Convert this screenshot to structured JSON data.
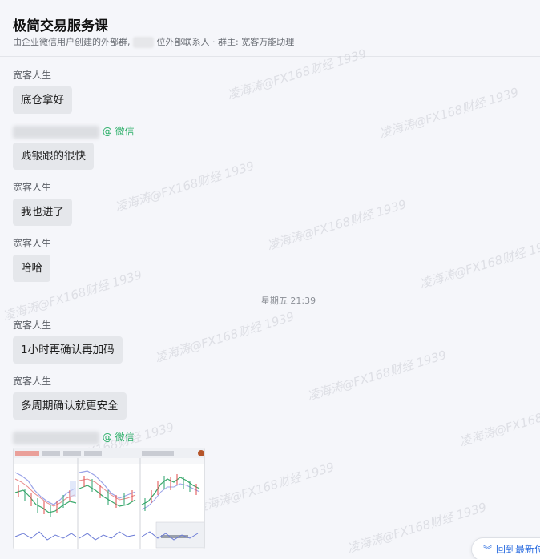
{
  "header": {
    "title": "极简交易服务课",
    "subtitle_prefix": "由企业微信用户创建的外部群,",
    "subtitle_suffix": "位外部联系人 · 群主: 宽客万能助理"
  },
  "messages": [
    {
      "sender": "宽客人生",
      "text": "底仓拿好"
    },
    {
      "sender_suffix": "@ 微信",
      "text": "贱银跟的很快"
    },
    {
      "sender": "宽客人生",
      "text": "我也进了"
    },
    {
      "sender": "宽客人生",
      "text": "哈哈"
    },
    {
      "sender": "宽客人生",
      "text": "1小时再确认再加码"
    },
    {
      "sender": "宽客人生",
      "text": "多周期确认就更安全"
    },
    {
      "sender_suffix": "@ 微信"
    }
  ],
  "timestamp": "星期五 21:39",
  "watermark": "凌海涛@FX168财经 1939",
  "jump_button": {
    "label": "回到最新位",
    "icon": "double-chevron-down-icon"
  }
}
